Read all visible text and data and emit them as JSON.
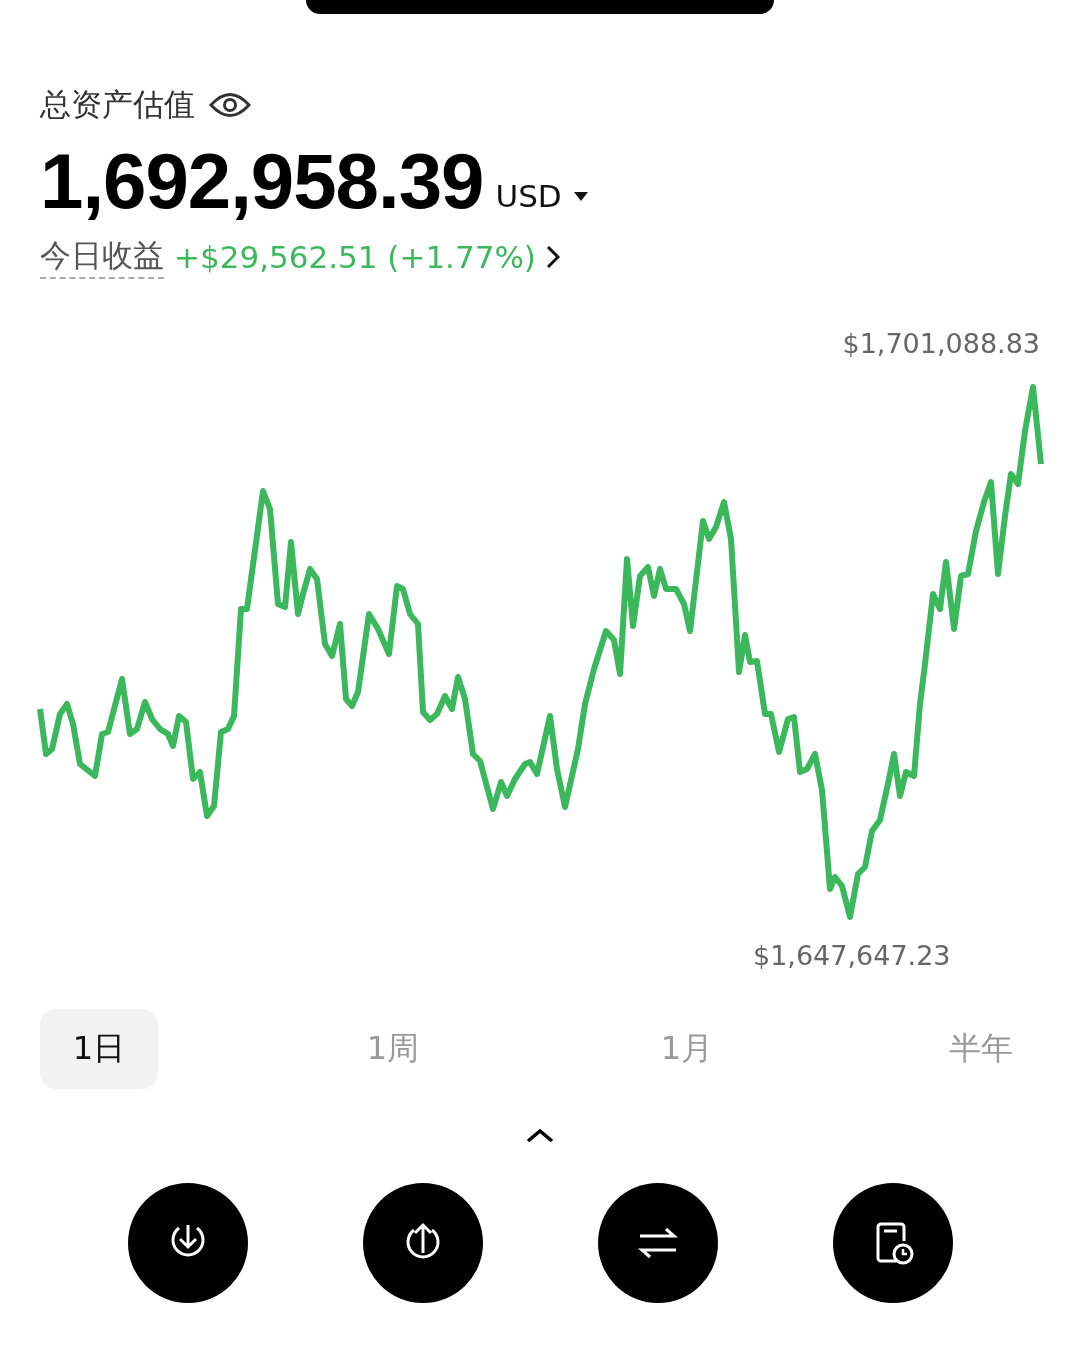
{
  "header": {
    "label": "总资产估值",
    "balance": "1,692,958.39",
    "currency": "USD",
    "pnl_label": "今日收益",
    "pnl_value": "+$29,562.51 (+1.77%)"
  },
  "chart": {
    "max_label": "$1,701,088.83",
    "min_label": "$1,647,647.23"
  },
  "periods": [
    {
      "label": "1日",
      "selected": true
    },
    {
      "label": "1周",
      "selected": false
    },
    {
      "label": "1月",
      "selected": false
    },
    {
      "label": "半年",
      "selected": false
    }
  ],
  "actions": [
    {
      "kind": "deposit"
    },
    {
      "kind": "withdraw"
    },
    {
      "kind": "transfer"
    },
    {
      "kind": "history"
    }
  ]
}
